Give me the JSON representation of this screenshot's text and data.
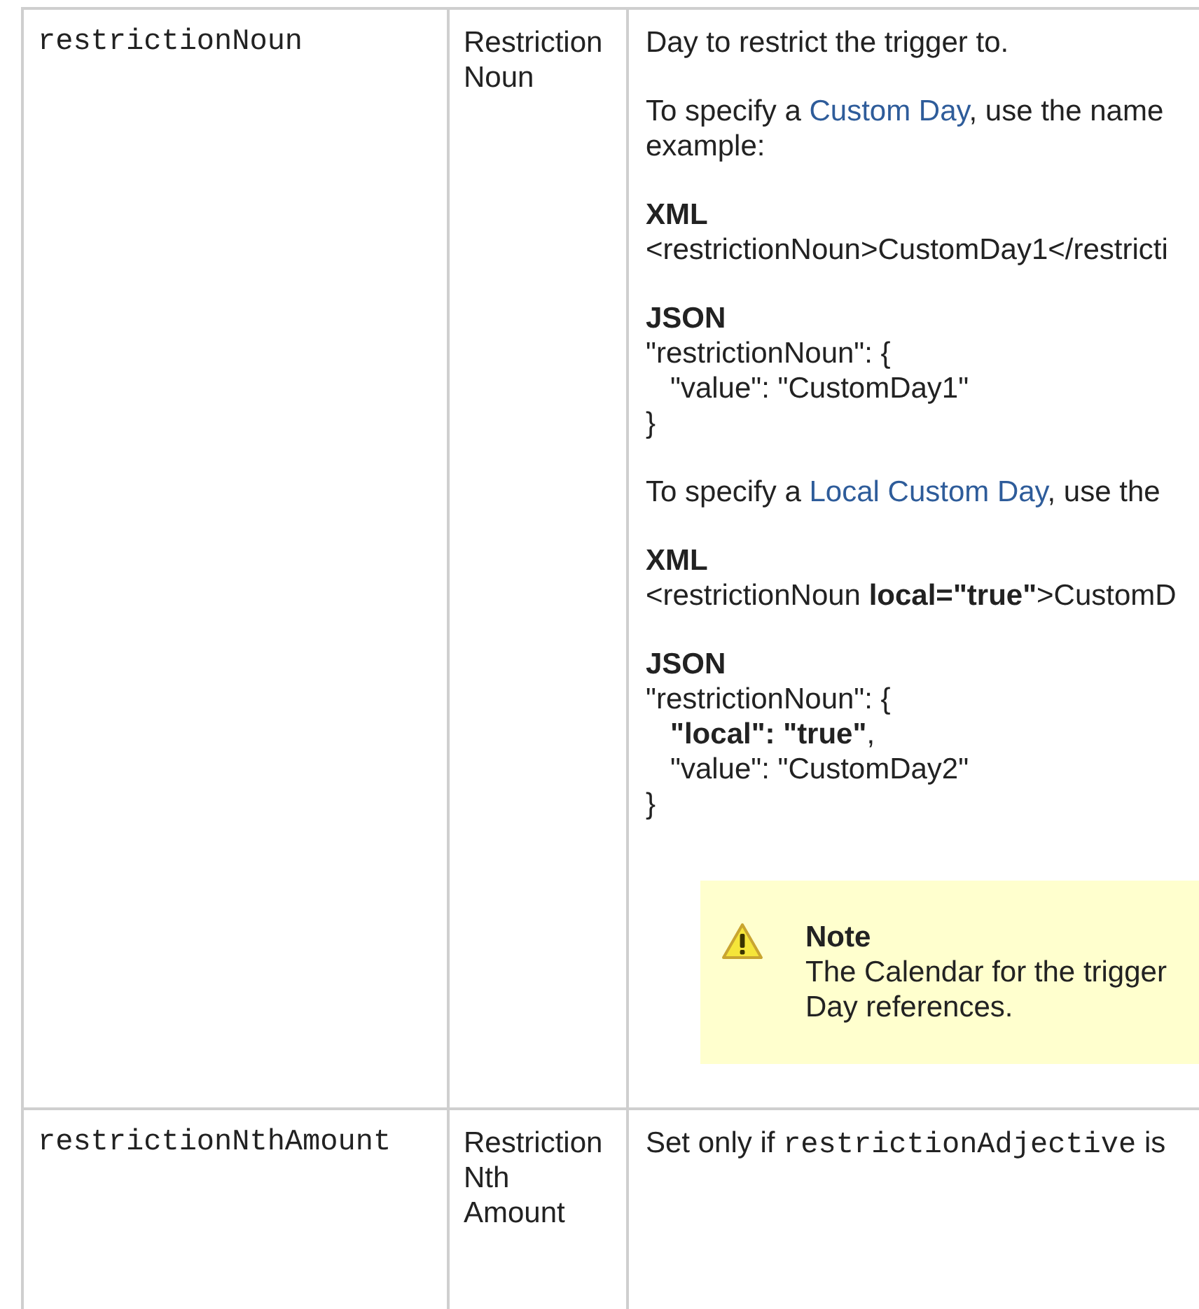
{
  "rows": [
    {
      "name": "restrictionNoun",
      "label": "Restriction Noun",
      "description": [
        {
          "kind": "paragraph",
          "lines": [
            [
              {
                "text": "Day to restrict the trigger to."
              }
            ]
          ]
        },
        {
          "kind": "paragraph",
          "lines": [
            [
              {
                "text": "To specify a "
              },
              {
                "text": "Custom Day",
                "link": true
              },
              {
                "text": ", use the name"
              }
            ],
            [
              {
                "text": "example:"
              }
            ]
          ]
        },
        {
          "kind": "code",
          "heading": "XML",
          "lines": [
            "<restrictionNoun>CustomDay1</restricti"
          ]
        },
        {
          "kind": "code",
          "heading": "JSON",
          "lines": [
            "\"restrictionNoun\": {",
            "   \"value\": \"CustomDay1\"",
            "}"
          ]
        },
        {
          "kind": "paragraph",
          "lines": [
            [
              {
                "text": "To specify a "
              },
              {
                "text": "Local Custom Day",
                "link": true
              },
              {
                "text": ", use the"
              }
            ]
          ]
        },
        {
          "kind": "code",
          "heading": "XML",
          "lines": [
            "<restrictionNoun **local=\"true\"**>CustomD"
          ]
        },
        {
          "kind": "code",
          "heading": "JSON",
          "lines": [
            "\"restrictionNoun\": {",
            "   **\"local\": \"true\"**,",
            "   \"value\": \"CustomDay2\"",
            "}"
          ]
        },
        {
          "kind": "note",
          "title": "Note",
          "lines": [
            "The Calendar for the trigger",
            "Day references."
          ]
        }
      ]
    },
    {
      "name": "restrictionNthAmount",
      "label": "Restriction Nth Amount",
      "description": [
        {
          "kind": "paragraph",
          "lines": [
            [
              {
                "text": "Set only if "
              },
              {
                "text": "restrictionAdjective",
                "code": true
              },
              {
                "text": " is"
              }
            ]
          ]
        }
      ]
    }
  ]
}
